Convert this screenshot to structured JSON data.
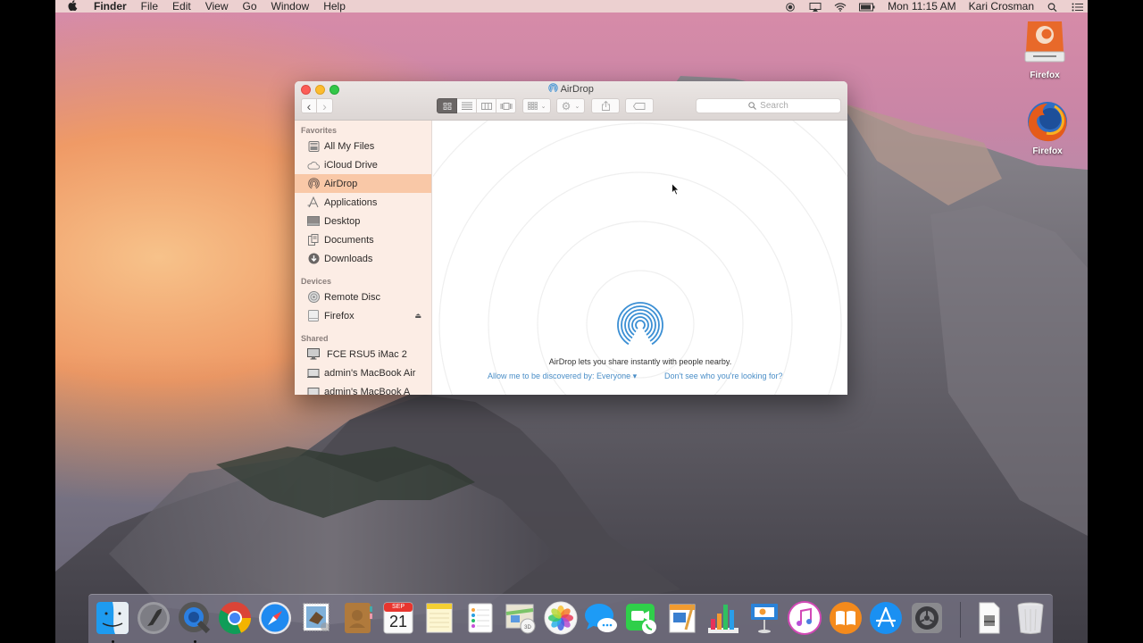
{
  "menubar": {
    "apple_icon": "apple-icon",
    "app_name": "Finder",
    "menus": [
      "File",
      "Edit",
      "View",
      "Go",
      "Window",
      "Help"
    ],
    "status_icons": [
      "record-icon",
      "airplay-icon",
      "wifi-icon",
      "battery-icon"
    ],
    "clock": "Mon 11:15 AM",
    "user": "Kari Crosman",
    "spotlight_icon": "spotlight-icon",
    "notification_icon": "notification-center-icon"
  },
  "desktop_icons": [
    {
      "label": "Firefox",
      "icon": "disk-image-icon"
    },
    {
      "label": "Firefox",
      "icon": "firefox-icon"
    }
  ],
  "finder": {
    "title": "AirDrop",
    "toolbar": {
      "back": "‹",
      "forward": "›",
      "view_modes": [
        "icon-view",
        "list-view",
        "column-view",
        "cover-flow-view"
      ],
      "arrange": "arrange-menu",
      "action": "action-menu",
      "share": "share-button",
      "tags": "tags-button",
      "search_placeholder": "Search"
    },
    "sidebar": {
      "sections": [
        {
          "header": "Favorites",
          "items": [
            {
              "label": "All My Files",
              "icon": "all-files-icon"
            },
            {
              "label": "iCloud Drive",
              "icon": "cloud-icon"
            },
            {
              "label": "AirDrop",
              "icon": "airdrop-icon",
              "selected": true
            },
            {
              "label": "Applications",
              "icon": "applications-icon"
            },
            {
              "label": "Desktop",
              "icon": "desktop-icon"
            },
            {
              "label": "Documents",
              "icon": "documents-icon"
            },
            {
              "label": "Downloads",
              "icon": "downloads-icon"
            }
          ]
        },
        {
          "header": "Devices",
          "items": [
            {
              "label": "Remote Disc",
              "icon": "disc-icon"
            },
            {
              "label": "Firefox",
              "icon": "drive-icon",
              "eject": true
            }
          ]
        },
        {
          "header": "Shared",
          "items": [
            {
              "label": "FCE RSU5 iMac 2",
              "icon": "imac-icon"
            },
            {
              "label": "admin's MacBook Air",
              "icon": "laptop-icon"
            },
            {
              "label": "admin's MacBook A",
              "icon": "laptop-icon"
            }
          ]
        }
      ]
    },
    "content": {
      "description": "AirDrop lets you share instantly with people nearby.",
      "discover_link": "Allow me to be discovered by: Everyone ▾",
      "help_link": "Don't see who you're looking for?"
    }
  },
  "dock": {
    "apps": [
      {
        "name": "Finder",
        "running": true
      },
      {
        "name": "Launchpad"
      },
      {
        "name": "QuickTime Player",
        "running": true
      },
      {
        "name": "Google Chrome"
      },
      {
        "name": "Safari"
      },
      {
        "name": "Mail"
      },
      {
        "name": "Contacts"
      },
      {
        "name": "Calendar",
        "month": "SEP",
        "day": "21"
      },
      {
        "name": "Notes"
      },
      {
        "name": "Reminders"
      },
      {
        "name": "Maps"
      },
      {
        "name": "Photos"
      },
      {
        "name": "Messages"
      },
      {
        "name": "FaceTime"
      },
      {
        "name": "Pages"
      },
      {
        "name": "Numbers"
      },
      {
        "name": "Keynote"
      },
      {
        "name": "iTunes"
      },
      {
        "name": "iBooks"
      },
      {
        "name": "App Store"
      },
      {
        "name": "System Preferences"
      }
    ],
    "right": [
      {
        "name": "Document"
      },
      {
        "name": "Trash"
      }
    ]
  },
  "colors": {
    "accent_blue": "#3b8fd4",
    "link_blue": "#4a8ec7",
    "sidebar_selection": "#f9c8a7"
  }
}
